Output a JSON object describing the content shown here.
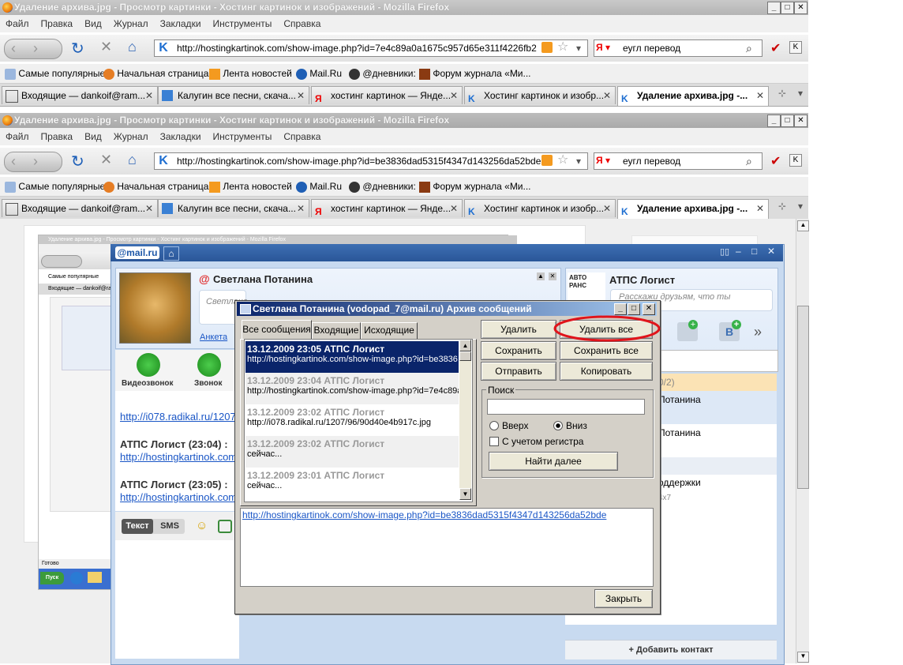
{
  "firefox_windows": [
    {
      "title": "Удаление архива.jpg - Просмотр картинки - Хостинг картинок и изображений - Mozilla Firefox",
      "url": "http://hostingkartinok.com/show-image.php?id=7e4c89a0a1675c957d65e311f4226fb2"
    },
    {
      "title": "Удаление архива.jpg - Просмотр картинки - Хостинг картинок и изображений - Mozilla Firefox",
      "url": "http://hostingkartinok.com/show-image.php?id=be3836dad5315f4347d143256da52bde"
    }
  ],
  "menu": [
    "Файл",
    "Правка",
    "Вид",
    "Журнал",
    "Закладки",
    "Инструменты",
    "Справка"
  ],
  "search_query": "еугл перевод",
  "bookmarks": [
    "Самые популярные",
    "Начальная страница",
    "Лента новостей",
    "Mail.Ru",
    "@дневники:",
    "Форум журнала «Ми..."
  ],
  "tabs": [
    "Входящие — dankoif@ram...",
    "Калугин все песни, скача...",
    "хостинг картинок — Янде...",
    "Хостинг картинок и изобр...",
    "Удаление архива.jpg -..."
  ],
  "thumbnail": {
    "title": "Удаление архива.jpg - Просмотр картинки - Хостинг картинок и изображений - Mozilla Firefox",
    "bookmark": "Самые популярные",
    "tab": "Входящие — dankoif@ram...",
    "status": "Готово",
    "start": "Пуск"
  },
  "agent": {
    "logo": "@mail.ru",
    "contact_name": "Светлана Потанина",
    "status_placeholder": "Светлана",
    "profile_link": "Анкета",
    "video_call": "Видеозвонок",
    "call": "Звонок",
    "chat_lines": [
      {
        "link": "http://i078.radikal.ru/1207"
      },
      {
        "sender": "АТПС Логист (23:04) :",
        "link": "http://hostingkartinok.com"
      },
      {
        "sender": "АТПС Логист (23:05) :",
        "link": "http://hostingkartinok.com"
      }
    ],
    "mode_text": "Текст",
    "mode_sms": "SMS",
    "right_name": "АТПС Логист",
    "right_avatar_text": "АВТО РАНС",
    "right_status_placeholder": "Расскажи друзьям, что ты",
    "group_count": "0/2)",
    "contacts": [
      "Потанина",
      "Потанина",
      "оддержки"
    ],
    "contact_sub": "4х7",
    "add_contact": "+ Добавить контакт"
  },
  "dialog": {
    "title": "Светлана Потанина (vodopad_7@mail.ru) Архив сообщений",
    "tabs": [
      "Все сообщения",
      "Входящие",
      "Исходящие"
    ],
    "messages": [
      {
        "header": "13.12.2009 23:05 АТПС Логист",
        "body": "http://hostingkartinok.com/show-image.php?id=be3836"
      },
      {
        "header": "13.12.2009 23:04 АТПС Логист",
        "body": "http://hostingkartinok.com/show-image.php?id=7e4c89a"
      },
      {
        "header": "13.12.2009 23:02 АТПС Логист",
        "body": "http://i078.radikal.ru/1207/96/90d40e4b917c.jpg"
      },
      {
        "header": "13.12.2009 23:02 АТПС Логист",
        "body": "сейчас..."
      },
      {
        "header": "13.12.2009 23:01 АТПС Логист",
        "body": "сейчас..."
      }
    ],
    "buttons": {
      "delete": "Удалить",
      "delete_all": "Удалить все",
      "save": "Сохранить",
      "save_all": "Сохранить все",
      "send": "Отправить",
      "copy": "Копировать",
      "find_next": "Найти далее",
      "close": "Закрыть"
    },
    "search_label": "Поиск",
    "search_value": "",
    "dir_up": "Вверх",
    "dir_down": "Вниз",
    "match_case": "С учетом регистра",
    "preview_link": "http://hostingkartinok.com/show-image.php?id=be3836dad5315f4347d143256da52bde"
  },
  "colors": {
    "highlight_ellipse": "#e0141b",
    "selection": "#0a246a"
  }
}
